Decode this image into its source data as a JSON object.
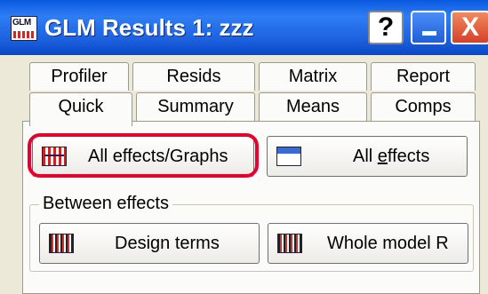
{
  "window": {
    "title": "GLM Results 1: zzz",
    "app_icon": "glm-app-icon",
    "help_label": "?",
    "close_label": "X"
  },
  "tabs": {
    "row1": [
      "Profiler",
      "Resids",
      "Matrix",
      "Report"
    ],
    "row2": [
      "Quick",
      "Summary",
      "Means",
      "Comps"
    ],
    "selected": "Quick"
  },
  "buttons": {
    "all_effects_graphs": {
      "label": "All effects/Graphs",
      "icon": "graph-icon"
    },
    "all_effects": {
      "label_pre": "All ",
      "label_underline": "e",
      "label_post": "ffects",
      "icon": "summary-table-icon"
    },
    "design_terms": {
      "label": "Design terms",
      "icon": "grid-table-icon"
    },
    "whole_model_r": {
      "label": "Whole model R",
      "icon": "grid-table-icon"
    }
  },
  "group": {
    "label": "Between effects"
  },
  "colors": {
    "titlebar": "#1d63e0",
    "highlight": "#e6002c",
    "face": "#ece9d8"
  }
}
